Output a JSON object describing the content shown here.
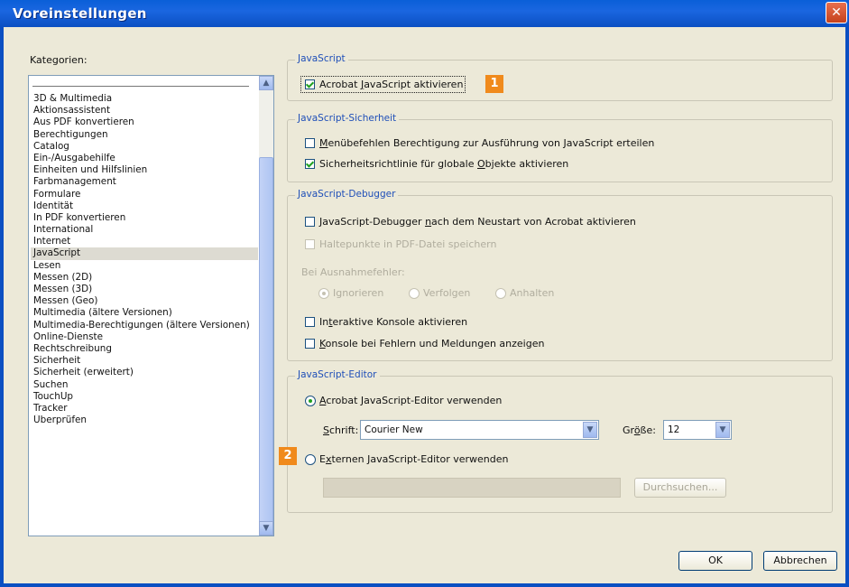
{
  "window": {
    "title": "Voreinstellungen",
    "close_label": "✕"
  },
  "categories": {
    "label": "Kategorien:",
    "items": [
      "3D & Multimedia",
      "Aktionsassistent",
      "Aus PDF konvertieren",
      "Berechtigungen",
      "Catalog",
      "Ein-/Ausgabehilfe",
      "Einheiten und Hilfslinien",
      "Farbmanagement",
      "Formulare",
      "Identität",
      "In PDF konvertieren",
      "International",
      "Internet",
      "JavaScript",
      "Lesen",
      "Messen (2D)",
      "Messen (3D)",
      "Messen (Geo)",
      "Multimedia (ältere Versionen)",
      "Multimedia-Berechtigungen (ältere Versionen)",
      "Online-Dienste",
      "Rechtschreibung",
      "Sicherheit",
      "Sicherheit (erweitert)",
      "Suchen",
      "TouchUp",
      "Tracker",
      "Überprüfen"
    ],
    "selected": "JavaScript"
  },
  "js": {
    "legend": "JavaScript",
    "enable_pre": "Acrobat ",
    "enable_u": "J",
    "enable_post": "avaScript aktivieren",
    "enable_checked": true
  },
  "security": {
    "legend": "JavaScript-Sicherheit",
    "menu_u": "M",
    "menu_post": "enübefehlen Berechtigung zur Ausführung von JavaScript erteilen",
    "menu_checked": false,
    "global_pre": "Sicherheitsrichtlinie für globale ",
    "global_u": "O",
    "global_post": "bjekte aktivieren",
    "global_checked": true
  },
  "debugger": {
    "legend": "JavaScript-Debugger",
    "restart_pre": "JavaScript-Debugger ",
    "restart_u": "n",
    "restart_post": "ach dem Neustart von Acrobat aktivieren",
    "breakpoints": "Haltepunkte in PDF-Datei speichern",
    "on_error": "Bei Ausnahmefehler:",
    "ignore": "Ignorieren",
    "follow": "Verfolgen",
    "stop": "Anhalten",
    "console_pre": "In",
    "console_u": "t",
    "console_post": "eraktive Konsole aktivieren",
    "show_u": "K",
    "show_post": "onsole bei Fehlern und Meldungen anzeigen"
  },
  "editor": {
    "legend": "JavaScript-Editor",
    "acrobat_u": "A",
    "acrobat_post": "crobat JavaScript-Editor verwenden",
    "font_u": "S",
    "font_post": "chrift:",
    "font_value": "Courier New",
    "size_pre": "Gr",
    "size_u": "ö",
    "size_post": "ße:",
    "size_value": "12",
    "external_pre": "E",
    "external_u": "x",
    "external_post": "ternen JavaScript-Editor verwenden",
    "browse": "Durchsuchen..."
  },
  "buttons": {
    "ok": "OK",
    "cancel": "Abbrechen"
  },
  "badges": {
    "one": "1",
    "two": "2"
  },
  "colors": {
    "badge": "#f08a1c",
    "legend_text": "#1f4fb8",
    "titlebar": "#0a5fd8"
  }
}
